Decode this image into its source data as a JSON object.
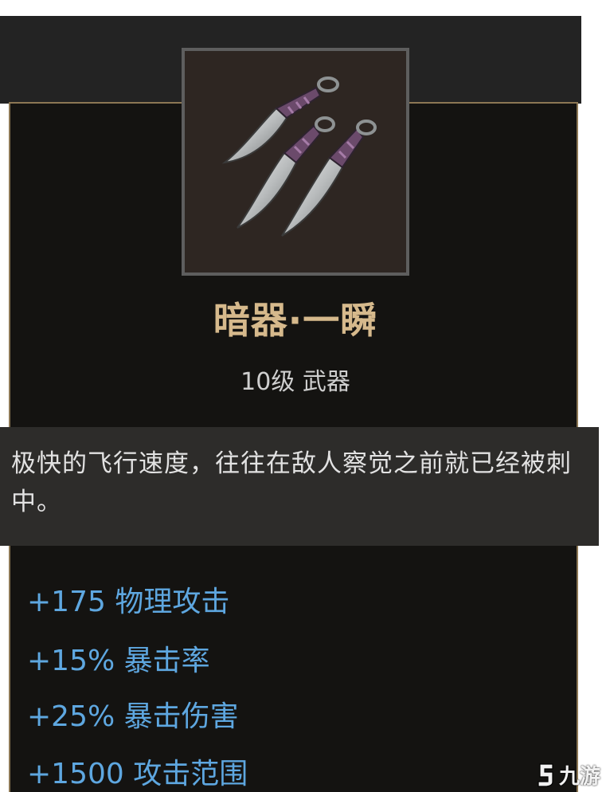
{
  "item": {
    "name": "暗器·一瞬",
    "level_type": "10级 武器",
    "icon": "throwing-knives-icon",
    "description": "极快的飞行速度，往往在敌人察觉之前就已经被刺中。"
  },
  "stats": [
    {
      "text": "+175 物理攻击"
    },
    {
      "text": "+15% 暴击率"
    },
    {
      "text": "+25% 暴击伤害"
    },
    {
      "text": "+1500 攻击范围"
    }
  ],
  "watermark": {
    "text": "九游",
    "icon": "jiuyou-logo-icon"
  },
  "colors": {
    "name": "#d6b98c",
    "stat": "#5ea7e0",
    "border": "#8c7754"
  }
}
